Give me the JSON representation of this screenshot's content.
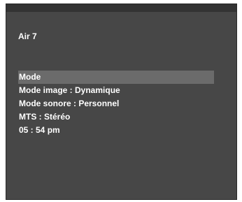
{
  "channel_label": "Air  7",
  "menu": {
    "items": [
      {
        "label": "Mode"
      },
      {
        "label": "Mode image : Dynamique"
      },
      {
        "label": "Mode sonore : Personnel"
      },
      {
        "label": "MTS : Stéréo"
      },
      {
        "label": "05 : 54 pm"
      }
    ],
    "selected_index": 0
  },
  "colors": {
    "background": "#474747",
    "highlight": "#6b6b6b",
    "text": "#ffffff"
  }
}
